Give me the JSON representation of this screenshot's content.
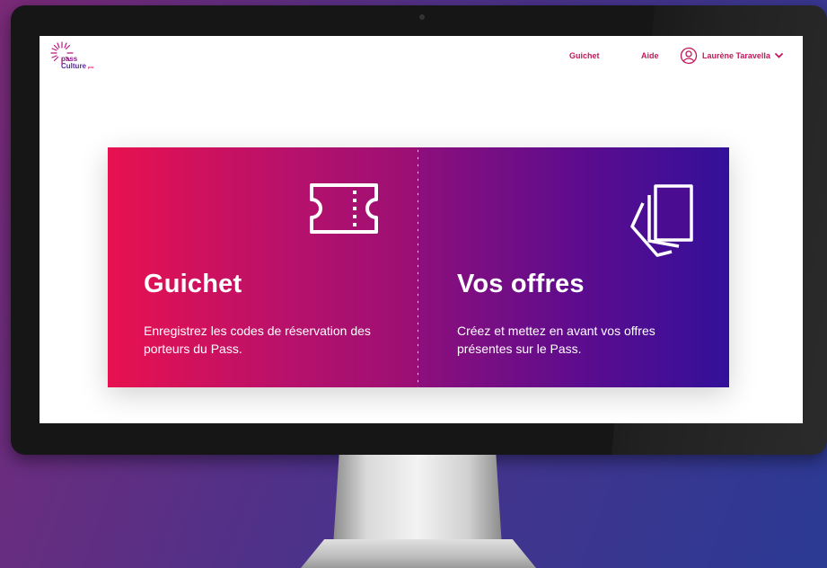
{
  "app": {
    "logo": {
      "line1": "pass",
      "line2": "Culture",
      "tag": "pro"
    }
  },
  "header": {
    "nav": [
      {
        "label": "Guichet"
      },
      {
        "label": "Aide"
      }
    ],
    "user": {
      "name": "Laurène Taravella",
      "icon": "user-circle-icon",
      "menu_icon": "chevron-down-icon"
    }
  },
  "cards": [
    {
      "title": "Guichet",
      "description": "Enregistrez les codes de réservation des porteurs du Pass.",
      "icon": "ticket-icon"
    },
    {
      "title": "Vos offres",
      "description": "Créez et mettez en avant vos offres présentes sur le Pass.",
      "icon": "offers-stack-icon"
    }
  ],
  "colors": {
    "brand_pink": "#e8114f",
    "brand_violet": "#33109a",
    "nav_text": "#c2185b"
  }
}
